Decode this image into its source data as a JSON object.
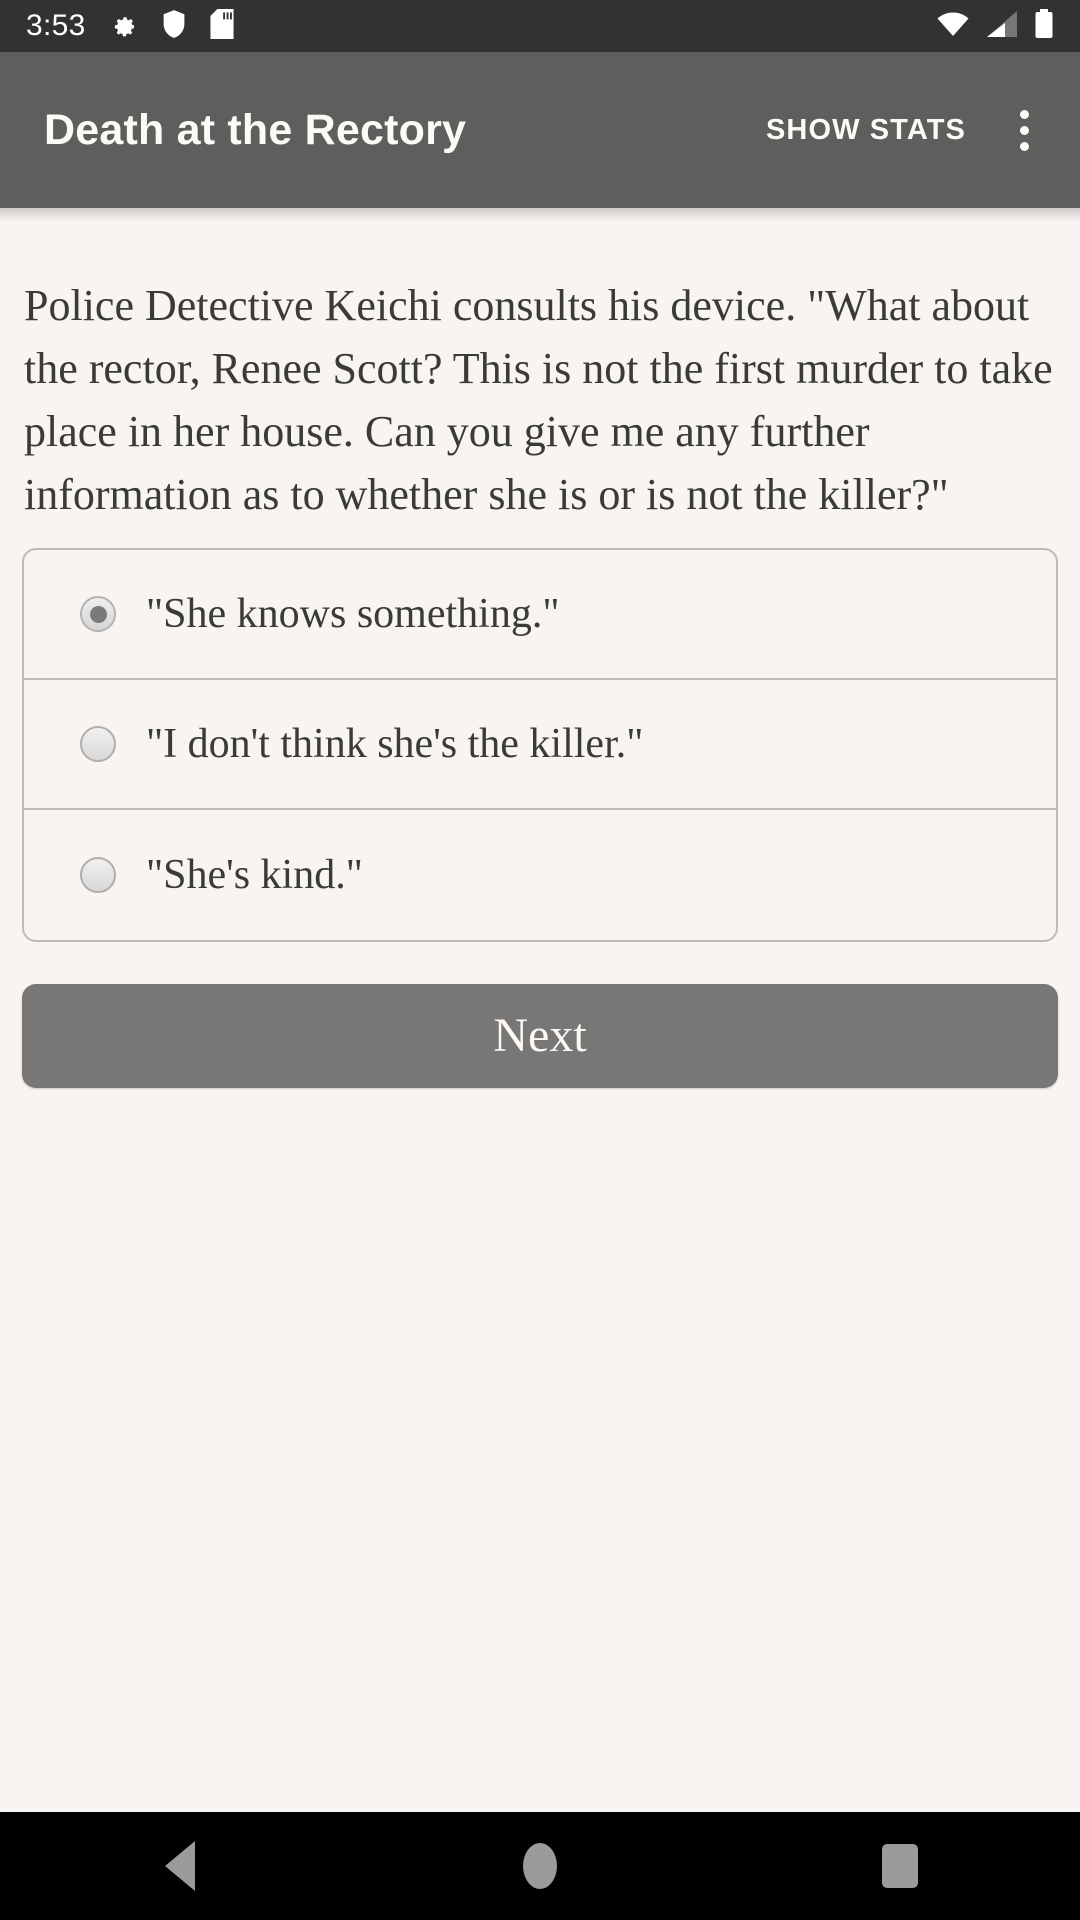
{
  "status_bar": {
    "clock": "3:53",
    "left_icons": [
      "gear-icon",
      "shield-icon",
      "sd-card-icon"
    ],
    "right_icons": [
      "wifi-icon",
      "cellular-signal-icon",
      "battery-icon"
    ],
    "background_color": "#333230",
    "foreground_color": "#FFFFFF"
  },
  "app_bar": {
    "title": "Death at the Rectory",
    "action_label": "SHOW STATS",
    "overflow_icon": "more-vert-icon",
    "background_color": "#5E5E5C",
    "text_color": "#FCFAF7"
  },
  "main": {
    "narrative": "Police Detective Keichi consults his device. \"What about the rector, Renee Scott? This is not the first murder to take place in her house. Can you give me any further information as to whether she is or is not the killer?\"",
    "options": [
      {
        "label": "\"She knows something.\"",
        "selected": true
      },
      {
        "label": "\"I don't think she's the killer.\"",
        "selected": false
      },
      {
        "label": "\"She's kind.\"",
        "selected": false
      }
    ],
    "next_button_label": "Next",
    "background_color": "#F7F4F1",
    "text_color": "#3A3A38",
    "button_color": "#787775"
  },
  "nav_bar": {
    "items": [
      "back-icon",
      "home-icon",
      "recents-icon"
    ],
    "background_color": "#000000",
    "icon_color": "#9A9A9A"
  }
}
